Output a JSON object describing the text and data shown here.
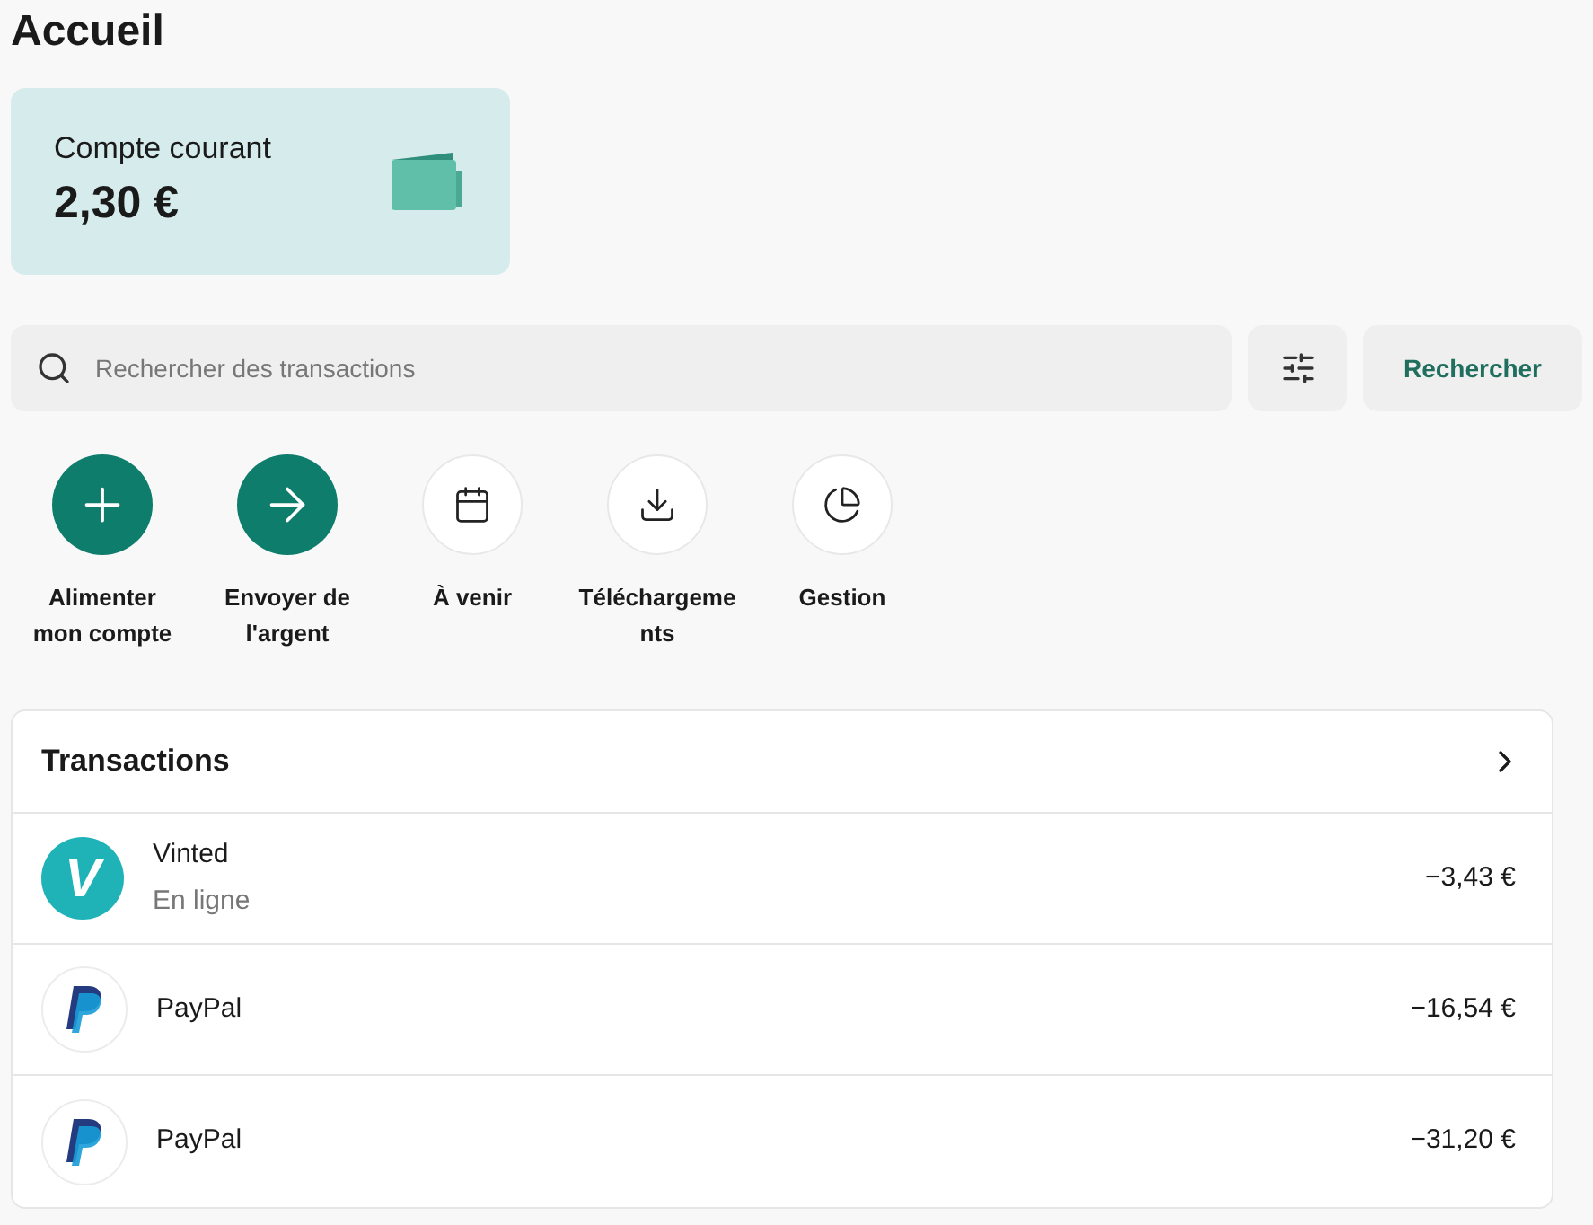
{
  "page_title": "Accueil",
  "account": {
    "label": "Compte courant",
    "balance": "2,30 €"
  },
  "search": {
    "placeholder": "Rechercher des transactions",
    "button": "Rechercher"
  },
  "actions": [
    {
      "label": "Alimenter mon compte",
      "kind": "primary"
    },
    {
      "label": "Envoyer de l'argent",
      "kind": "primary"
    },
    {
      "label": "À venir",
      "kind": "secondary"
    },
    {
      "label": "Téléchargements",
      "kind": "secondary"
    },
    {
      "label": "Gestion",
      "kind": "secondary"
    }
  ],
  "transactions": {
    "title": "Transactions",
    "rows": [
      {
        "merchant": "Vinted",
        "subtitle": "En ligne",
        "amount": "−3,43 €",
        "logo": {
          "kind": "letter",
          "text": "V"
        }
      },
      {
        "merchant": "PayPal",
        "amount": "−16,54 €",
        "logo": {
          "kind": "mark"
        }
      },
      {
        "merchant": "PayPal",
        "amount": "−31,20 €",
        "logo": {
          "kind": "mark"
        }
      }
    ]
  }
}
